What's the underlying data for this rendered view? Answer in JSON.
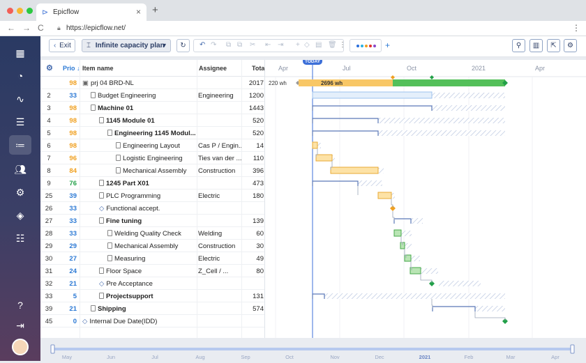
{
  "browser": {
    "tab_title": "Epicflow",
    "tab_close": "×",
    "new_tab": "+",
    "url": "https://epicflow.net/",
    "back": "←",
    "forward": "→",
    "reload": "C",
    "menu": "⋮"
  },
  "toolbar": {
    "exit_label": "Exit",
    "exit_icon": "‹",
    "plan_label": "Infinite capacity plan",
    "plan_icon": "⌶",
    "plan_caret": "▾",
    "refresh_icon": "↻",
    "add": "+",
    "color_dots": [
      "#2a6fdb",
      "#2ab0e0",
      "#f0a020",
      "#e03030",
      "#8a48c8"
    ]
  },
  "grid": {
    "headers": {
      "prio": "Prio ↓",
      "item": "Item name",
      "assignee": "Assignee",
      "total": "Tota"
    },
    "settings_icon": "⚙",
    "rows": [
      {
        "no": "",
        "prio": "98",
        "prio_color": "#f0a020",
        "name": "prj 04 BRD-NL",
        "indent": 0,
        "bold": false,
        "assignee": "",
        "total": "2017"
      },
      {
        "no": "2",
        "prio": "33",
        "prio_color": "#2a78d4",
        "name": "Budget Engineering",
        "indent": 1,
        "bold": false,
        "assignee": "Engineering",
        "total": "1200"
      },
      {
        "no": "3",
        "prio": "98",
        "prio_color": "#f0a020",
        "name": "Machine 01",
        "indent": 1,
        "bold": true,
        "assignee": "",
        "total": "1443"
      },
      {
        "no": "4",
        "prio": "98",
        "prio_color": "#f0a020",
        "name": "1145 Module 01",
        "indent": 2,
        "bold": true,
        "assignee": "",
        "total": "520"
      },
      {
        "no": "5",
        "prio": "98",
        "prio_color": "#f0a020",
        "name": "Engineering 1145 Modul...",
        "indent": 3,
        "bold": true,
        "assignee": "",
        "total": "520"
      },
      {
        "no": "6",
        "prio": "98",
        "prio_color": "#f0a020",
        "name": "Engineering Layout",
        "indent": 4,
        "bold": false,
        "assignee": "Cas P / Engin...",
        "total": "14"
      },
      {
        "no": "7",
        "prio": "96",
        "prio_color": "#f0a020",
        "name": "Logistic Engineering",
        "indent": 4,
        "bold": false,
        "assignee": "Ties van der ...",
        "total": "110"
      },
      {
        "no": "8",
        "prio": "84",
        "prio_color": "#f0a020",
        "name": "Mechanical Assembly",
        "indent": 4,
        "bold": false,
        "assignee": "Construction",
        "total": "396"
      },
      {
        "no": "9",
        "prio": "76",
        "prio_color": "#22a048",
        "name": "1245 Part X01",
        "indent": 2,
        "bold": true,
        "assignee": "",
        "total": "473"
      },
      {
        "no": "25",
        "prio": "39",
        "prio_color": "#2a78d4",
        "name": "PLC Programming",
        "indent": 2,
        "bold": false,
        "assignee": "Electric",
        "total": "180"
      },
      {
        "no": "26",
        "prio": "33",
        "prio_color": "#2a78d4",
        "name": "Functional accept.",
        "indent": 2,
        "bold": false,
        "assignee": "",
        "total": ""
      },
      {
        "no": "27",
        "prio": "33",
        "prio_color": "#2a78d4",
        "name": "Fine tuning",
        "indent": 2,
        "bold": true,
        "assignee": "",
        "total": "139"
      },
      {
        "no": "28",
        "prio": "33",
        "prio_color": "#2a78d4",
        "name": "Welding Quality Check",
        "indent": 3,
        "bold": false,
        "assignee": "Welding",
        "total": "60"
      },
      {
        "no": "29",
        "prio": "29",
        "prio_color": "#2a78d4",
        "name": "Mechanical Assembly",
        "indent": 3,
        "bold": false,
        "assignee": "Construction",
        "total": "30"
      },
      {
        "no": "30",
        "prio": "27",
        "prio_color": "#2a78d4",
        "name": "Measuring",
        "indent": 3,
        "bold": false,
        "assignee": "Electric",
        "total": "49"
      },
      {
        "no": "31",
        "prio": "24",
        "prio_color": "#2a78d4",
        "name": "Floor Space",
        "indent": 2,
        "bold": false,
        "assignee": "Z_Cell / ...",
        "total": "80"
      },
      {
        "no": "32",
        "prio": "21",
        "prio_color": "#2a78d4",
        "name": "Pre Acceptance",
        "indent": 2,
        "bold": false,
        "assignee": "",
        "total": ""
      },
      {
        "no": "33",
        "prio": "5",
        "prio_color": "#2a78d4",
        "name": "Projectsupport",
        "indent": 2,
        "bold": true,
        "assignee": "",
        "total": "131"
      },
      {
        "no": "39",
        "prio": "21",
        "prio_color": "#2a78d4",
        "name": "Shipping",
        "indent": 1,
        "bold": true,
        "assignee": "",
        "total": "574"
      },
      {
        "no": "45",
        "prio": "0",
        "prio_color": "#2a78d4",
        "name": "Internal Due Date(IDD)",
        "indent": 0,
        "bold": false,
        "assignee": "",
        "total": ""
      }
    ]
  },
  "gantt": {
    "months": [
      "Apr",
      "Jul",
      "Oct",
      "2021",
      "Apr"
    ],
    "today_label": "TODAY",
    "project_hours_left": "220 wh",
    "project_hours_right": "2696 wh"
  },
  "timeline": {
    "months": [
      "May",
      "Jun",
      "Jul",
      "Aug",
      "Sep",
      "Oct",
      "Nov",
      "Dec",
      "2021",
      "Feb",
      "Mar",
      "Apr"
    ]
  }
}
